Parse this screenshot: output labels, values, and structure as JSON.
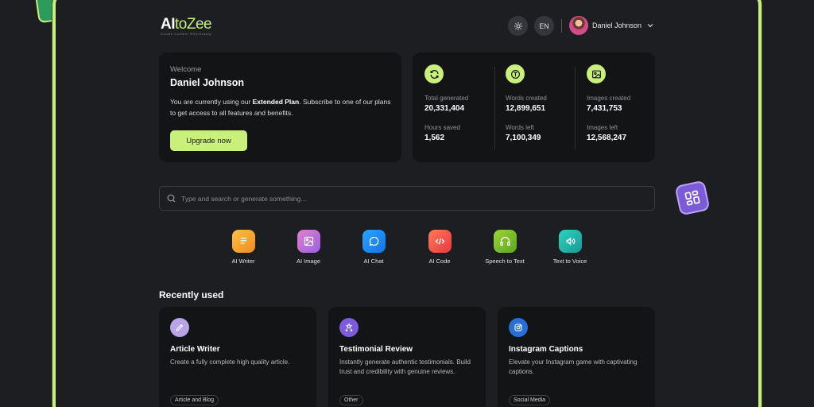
{
  "header": {
    "logo_main": "AI",
    "logo_accent": "toZee",
    "logo_sub": "Create Content Effortlessly",
    "theme_icon": "sun-icon",
    "language": "EN",
    "user_name": "Daniel Johnson",
    "chevron_icon": "chevron-down-icon"
  },
  "welcome": {
    "label": "Welcome",
    "name": "Daniel Johnson",
    "text_before": "You are currently using our ",
    "plan": "Extended Plan",
    "text_after": ". Subscribe to one of our plans to get access to all features and benefits.",
    "button": "Upgrade now"
  },
  "stats": {
    "col1": {
      "icon": "refresh-icon",
      "label1": "Total generated",
      "value1": "20,331,404",
      "label2": "Hours saved",
      "value2": "1,562"
    },
    "col2": {
      "icon": "text-icon",
      "label1": "Words created",
      "value1": "12,899,651",
      "label2": "Words left",
      "value2": "7,100,349"
    },
    "col3": {
      "icon": "image-icon",
      "label1": "Images created",
      "value1": "7,431,753",
      "label2": "Images left",
      "value2": "12,568,247"
    }
  },
  "search": {
    "placeholder": "Type and search or generate something..."
  },
  "tools": [
    {
      "label": "AI Writer",
      "icon": "document-icon",
      "color": "#f5a623"
    },
    {
      "label": "AI Image",
      "icon": "image-icon",
      "color": "#c56ad6"
    },
    {
      "label": "AI Chat",
      "icon": "chat-icon",
      "color": "#1f8ef1"
    },
    {
      "label": "AI Code",
      "icon": "code-icon",
      "color": "#f0524a"
    },
    {
      "label": "Speech to Text",
      "icon": "headphones-icon",
      "color": "#7cc12a"
    },
    {
      "label": "Text to Voice",
      "icon": "speaker-icon",
      "color": "#1fb8b0"
    }
  ],
  "recent": {
    "title": "Recently used",
    "items": [
      {
        "title": "Article Writer",
        "desc": "Create a fully complete high quality article.",
        "tag": "Article and Blog",
        "icon": "pencil-icon",
        "color": "#b7a5e6"
      },
      {
        "title": "Testimonial Review",
        "desc": "Instantly generate authentic testimonials. Build trust and credibility with genuine reviews.",
        "tag": "Other",
        "icon": "stars-icon",
        "color": "#7d5cdc"
      },
      {
        "title": "Instagram Captions",
        "desc": "Elevate your Instagram game with captivating captions.",
        "tag": "Social Media",
        "icon": "instagram-icon",
        "color": "#2a6fd6"
      }
    ]
  },
  "colors": {
    "accent": "#c9f07a",
    "card": "#131416",
    "background": "#1d1e21"
  }
}
